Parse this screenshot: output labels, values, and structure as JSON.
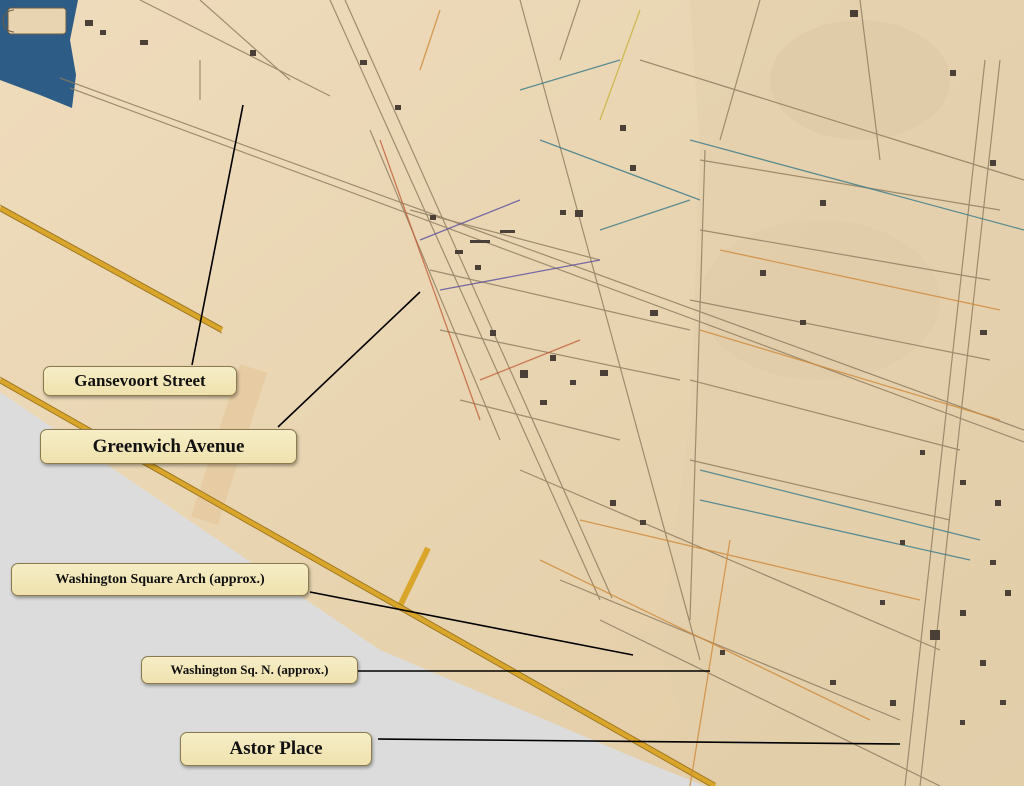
{
  "map": {
    "labels": {
      "gansevoort": "Gansevoort Street",
      "greenwich": "Greenwich Avenue",
      "arch": "Washington Square Arch (approx.)",
      "wsn": "Washington Sq. N. (approx.)",
      "astor": "Astor Place"
    },
    "colors": {
      "paper": "#e9d7b6",
      "water": "#2d5d86",
      "margin": "#dcdcdc",
      "label_fill": "#f3e8bb",
      "leader": "#000000",
      "highlight_road": "#d9a62b"
    }
  }
}
